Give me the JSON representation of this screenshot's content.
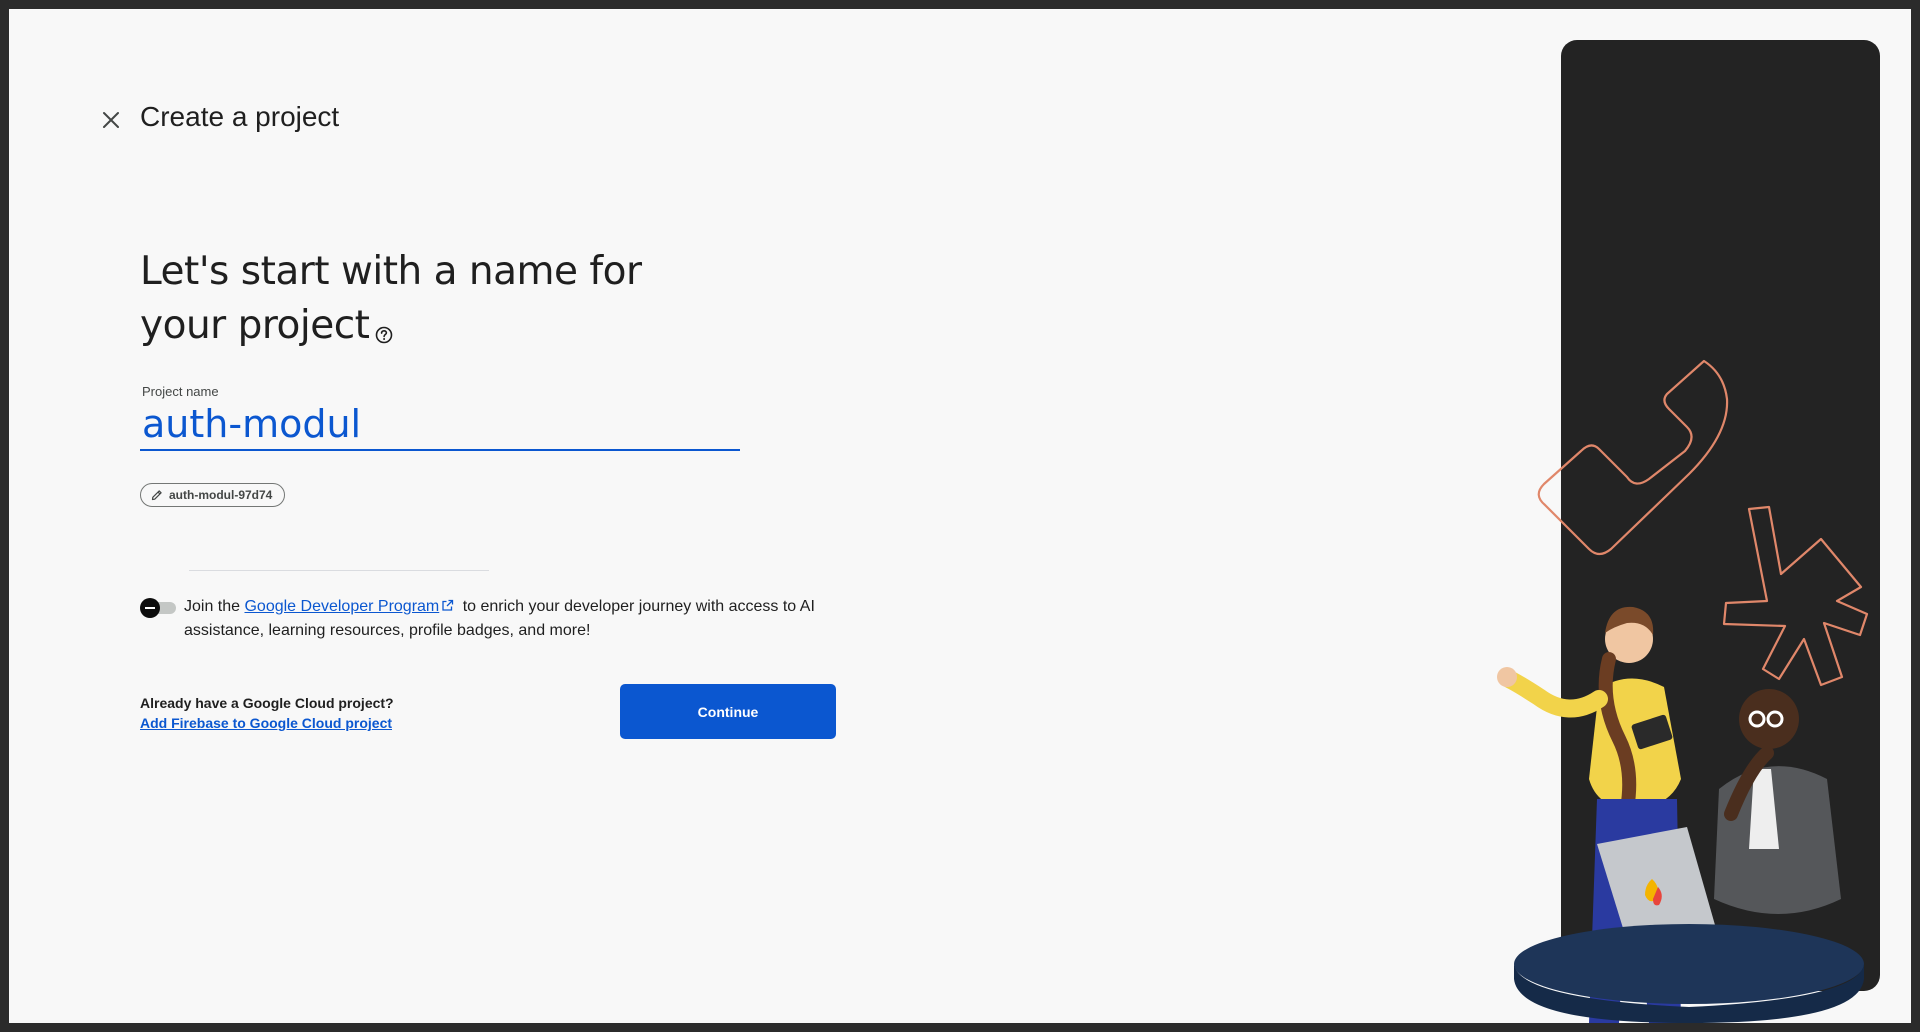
{
  "header": {
    "title": "Create a project"
  },
  "headline": {
    "line1": "Let's start with a name for",
    "line2": "your project"
  },
  "project_name": {
    "label": "Project name",
    "value": "auth-modul"
  },
  "project_id": {
    "value": "auth-modul-97d74"
  },
  "developer_program": {
    "toggle_on": false,
    "prefix": "Join the ",
    "link_text": "Google Developer Program",
    "suffix": " to enrich your developer journey with access to AI assistance, learning resources, profile badges, and more!"
  },
  "cloud": {
    "question": "Already have a Google Cloud project?",
    "link_text": "Add Firebase to Google Cloud project"
  },
  "actions": {
    "continue_label": "Continue"
  },
  "colors": {
    "accent": "#0b57d0",
    "page_background": "#f8f8f8",
    "panel": "#232323",
    "decor_orange": "#e0876a"
  }
}
